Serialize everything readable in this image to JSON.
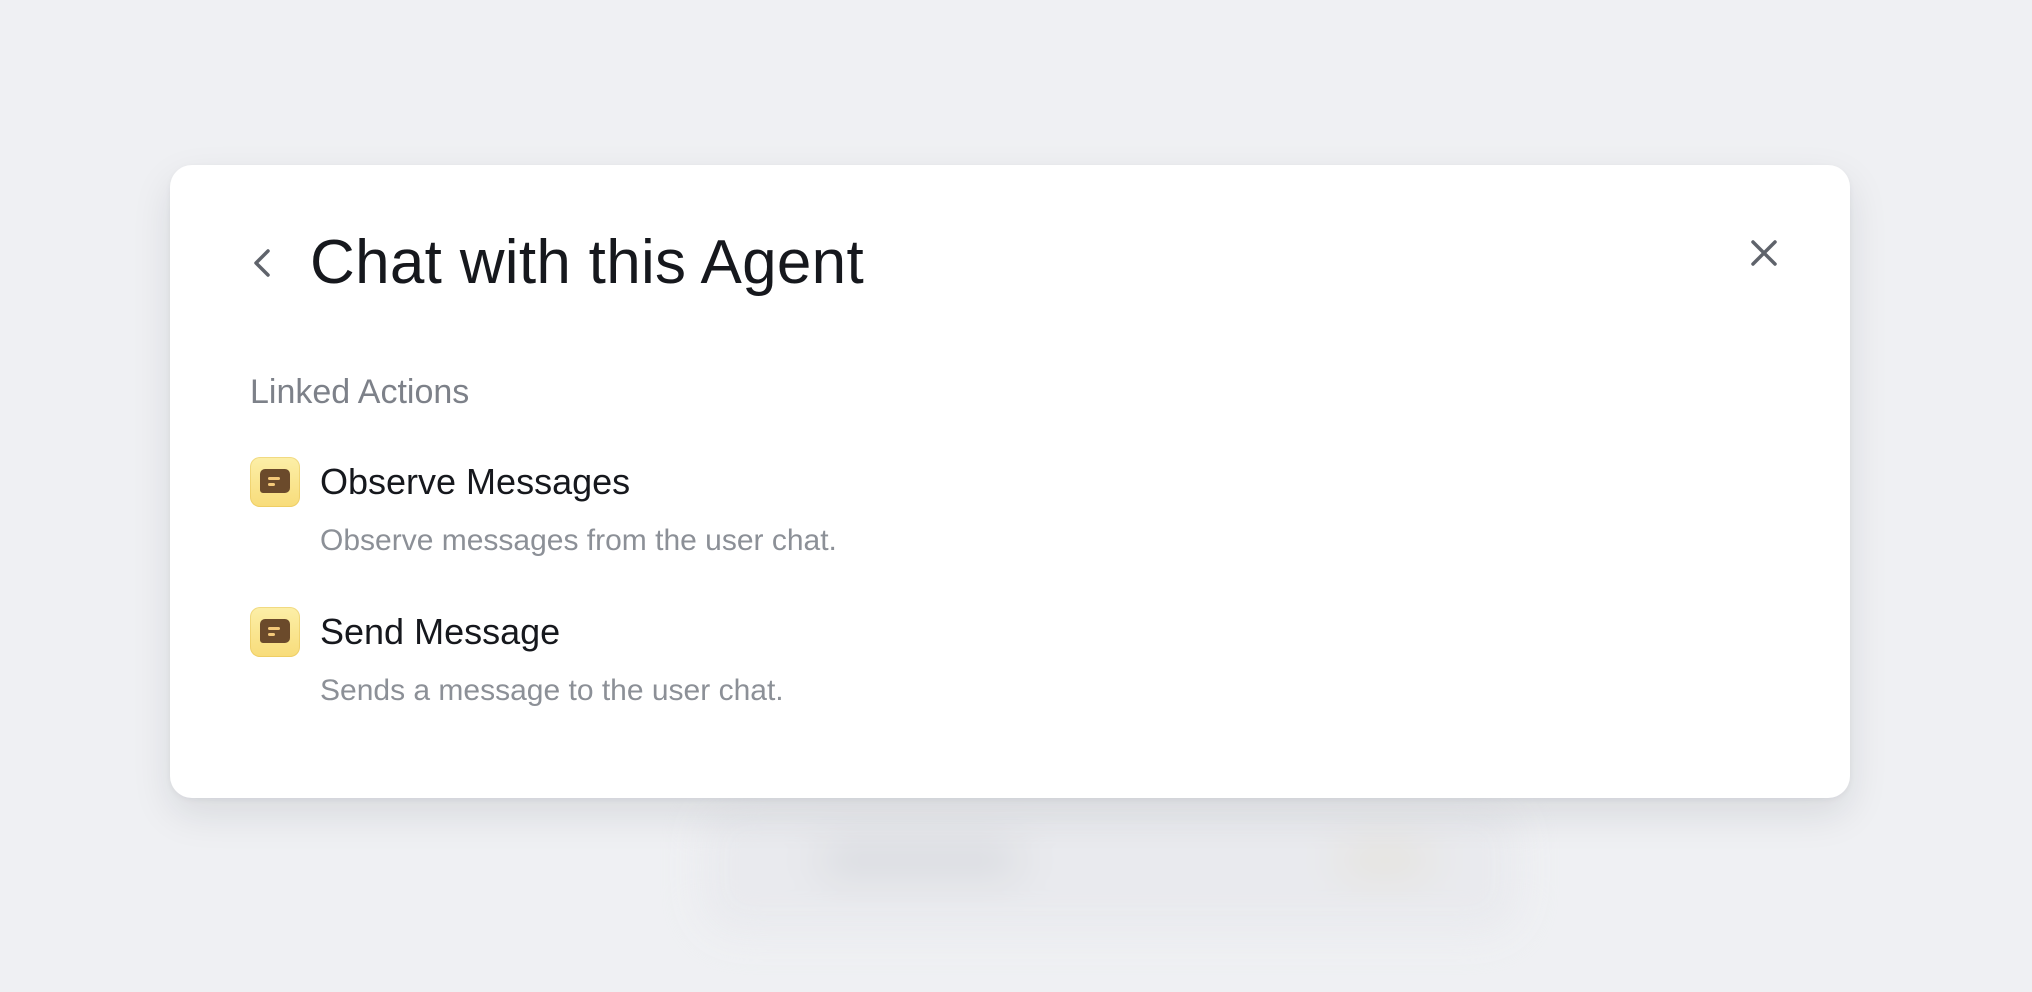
{
  "modal": {
    "title": "Chat with this Agent",
    "section_label": "Linked Actions",
    "actions": [
      {
        "name": "Observe Messages",
        "description": "Observe messages from the user chat.",
        "icon": "chat-bubble-icon"
      },
      {
        "name": "Send Message",
        "description": "Sends a message to the user chat.",
        "icon": "chat-bubble-icon"
      }
    ]
  },
  "icons": {
    "back": "chevron-left-icon",
    "close": "close-icon"
  },
  "colors": {
    "background": "#eff0f3",
    "modal": "#ffffff",
    "title": "#16181d",
    "muted_text": "#7d8189",
    "icon_tile": "#f8dc7a",
    "icon_glyph": "#6b4a2b"
  }
}
